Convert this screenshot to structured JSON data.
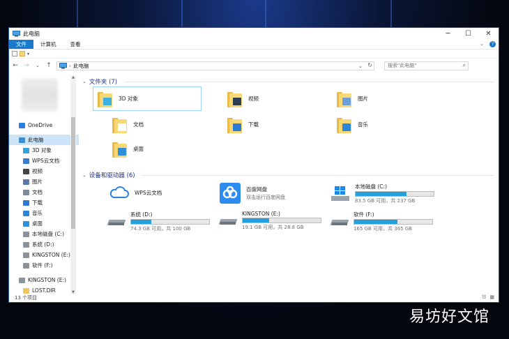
{
  "window": {
    "title": "此电脑",
    "minimize": "─",
    "maximize": "☐",
    "close": "✕"
  },
  "ribbon": {
    "tabs": [
      "文件",
      "计算机",
      "查看"
    ],
    "collapse": "⌄",
    "help": "?"
  },
  "nav": {
    "back": "←",
    "forward": "→",
    "recent": "⌄",
    "up": "↑",
    "address_root": "›",
    "address": "此电脑",
    "refresh": "↻",
    "search_placeholder": "搜索\"此电脑\""
  },
  "sidebar": {
    "items": [
      {
        "label": "OneDrive",
        "icon": "cloud-icon",
        "color": "#2a7fe0"
      },
      {
        "label": "此电脑",
        "icon": "computer-icon",
        "color": "#3a8fd9"
      },
      {
        "label": "3D 对象",
        "icon": "cube-icon",
        "color": "#33a3d9"
      },
      {
        "label": "WPS云文档",
        "icon": "cloud-outline-icon",
        "color": "#3a7bd5"
      },
      {
        "label": "视频",
        "icon": "film-icon",
        "color": "#444"
      },
      {
        "label": "图片",
        "icon": "picture-icon",
        "color": "#5c7aa8"
      },
      {
        "label": "文档",
        "icon": "document-icon",
        "color": "#7d8a99"
      },
      {
        "label": "下载",
        "icon": "download-icon",
        "color": "#2b7bd2"
      },
      {
        "label": "音乐",
        "icon": "music-icon",
        "color": "#2b86d9"
      },
      {
        "label": "桌面",
        "icon": "desktop-icon",
        "color": "#2f8fd8"
      },
      {
        "label": "本地磁盘 (C:)",
        "icon": "drive-icon",
        "color": "#8a939b"
      },
      {
        "label": "系统 (D:)",
        "icon": "drive-icon",
        "color": "#8a939b"
      },
      {
        "label": "KINGSTON (E:)",
        "icon": "drive-icon",
        "color": "#8a939b"
      },
      {
        "label": "软件 (F:)",
        "icon": "drive-icon",
        "color": "#8a939b"
      },
      {
        "label": "KINGSTON (E:)",
        "icon": "drive-icon",
        "color": "#8a939b"
      },
      {
        "label": "LOST.DIR",
        "icon": "folder-icon",
        "color": "#f0c75e"
      }
    ]
  },
  "folders_group": {
    "title": "文件夹 (7)",
    "items": [
      {
        "label": "3D 对象",
        "overlay": "#3cb0e0"
      },
      {
        "label": "视频",
        "overlay": "#2c3e50"
      },
      {
        "label": "图片",
        "overlay": "#6a9fd8"
      },
      {
        "label": "文档",
        "overlay": "#ffffff"
      },
      {
        "label": "下载",
        "overlay": "#2b7bd2"
      },
      {
        "label": "音乐",
        "overlay": "#2b86d9"
      },
      {
        "label": "桌面",
        "overlay": "#2f8fd8"
      }
    ]
  },
  "drives_group": {
    "title": "设备和驱动器 (6)",
    "items": [
      {
        "name": "WPS云文档",
        "sub": "",
        "used": null
      },
      {
        "name": "百度网盘",
        "sub": "双击运行百度网盘",
        "used": null
      },
      {
        "name": "本地磁盘 (C:)",
        "sub": "83.5 GB 可用，共 237 GB",
        "used": 0.65
      },
      {
        "name": "系统 (D:)",
        "sub": "74.3 GB 可用，共 100 GB",
        "used": 0.26
      },
      {
        "name": "KINGSTON (E:)",
        "sub": "19.1 GB 可用，共 28.8 GB",
        "used": 0.34
      },
      {
        "name": "软件 (F:)",
        "sub": "165 GB 可用，共 365 GB",
        "used": 0.55
      }
    ]
  },
  "status": {
    "count": "13 个项目"
  },
  "watermark": "易坊好文馆"
}
